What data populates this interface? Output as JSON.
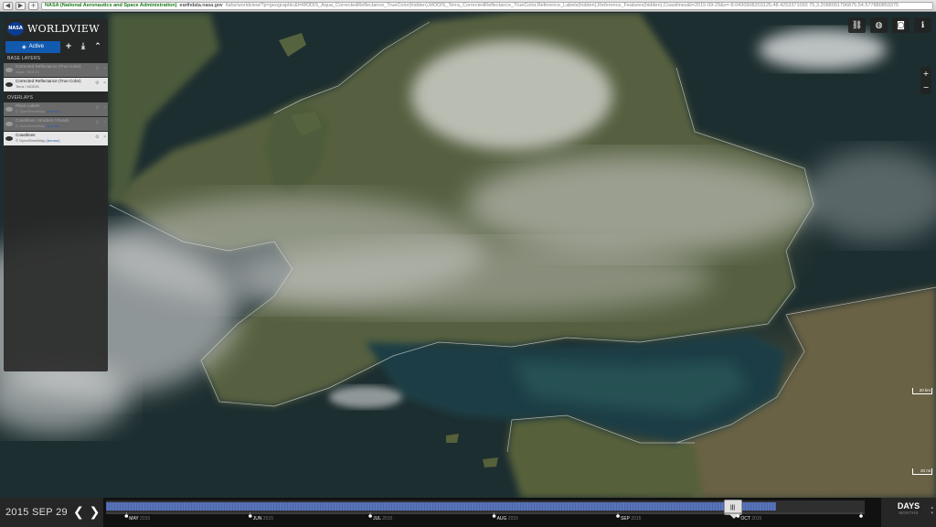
{
  "browser": {
    "site_identity": "NASA (National Aeronautics and Space Administration)",
    "host": "earthdata.nasa.gov",
    "path": "/labs/worldview/?p=geographic&l=MODIS_Aqua_CorrectedReflectance_TrueColor(hidden),MODIS_Terra_CorrectedReflectance_TrueColor,Reference_Labels(hidden),Reference_Features(hidden),Coastlines&t=2015-09-29&v=-8.0430908203125,48.4253371093 75,3.2088091796875,54.577880859375"
  },
  "app": {
    "logo_text": "NASA",
    "title": "WORLDVIEW"
  },
  "panel": {
    "active_tab": "Active",
    "add_icon_glyph": "+",
    "download_icon_glyph": "⤓",
    "collapse_icon_glyph": "⌃",
    "base_layers_heading": "BASE LAYERS",
    "overlays_heading": "OVERLAYS",
    "base_layers": [
      {
        "name": "Corrected Reflectance (True Color)",
        "source": "Aqua / MODIS",
        "visible": false
      },
      {
        "name": "Corrected Reflectance (True Color)",
        "source": "Terra / MODIS",
        "visible": true
      }
    ],
    "overlays": [
      {
        "name": "Place Labels",
        "source": "© OpenStreetMap",
        "source_link": "(license)",
        "visible": false
      },
      {
        "name": "Coastlines / Borders / Roads",
        "source": "© OpenStreetMap",
        "source_link": "(license)",
        "visible": false
      },
      {
        "name": "Coastlines",
        "source": "© OpenStreetMap",
        "source_link": "(license)",
        "visible": true
      }
    ]
  },
  "toolbar": {
    "icons": [
      "link-icon",
      "globe-icon",
      "camera-icon",
      "info-icon"
    ]
  },
  "zoom_controls": {
    "plus": "+",
    "minus": "−"
  },
  "scale": {
    "small": "20 km",
    "large": "20 mi"
  },
  "timeline": {
    "date": "2015 SEP 29",
    "prev_glyph": "❮",
    "next_glyph": "❯",
    "progress_fraction": 0.94,
    "handle_position_fraction": 0.826,
    "months": [
      {
        "label": "MAY",
        "year": "2015",
        "fraction": 0.027
      },
      {
        "label": "JUN",
        "year": "2015",
        "fraction": 0.191
      },
      {
        "label": "JUL",
        "year": "2015",
        "fraction": 0.35
      },
      {
        "label": "AUG",
        "year": "2015",
        "fraction": 0.514
      },
      {
        "label": "SEP",
        "year": "2015",
        "fraction": 0.678
      },
      {
        "label": "OCT",
        "year": "2015",
        "fraction": 0.837
      },
      {
        "label": "NOV",
        "year": "2015",
        "fraction": 1.0
      }
    ],
    "zoom_level": "DAYS",
    "zoom_sub": "MONTHS"
  }
}
